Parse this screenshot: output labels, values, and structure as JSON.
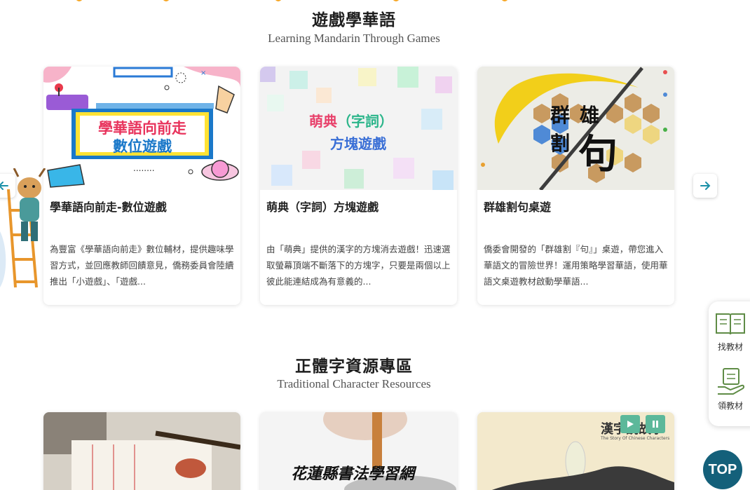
{
  "games": {
    "title": "遊戲學華語",
    "subtitle": "Learning Mandarin Through Games",
    "cards": [
      {
        "title": "學華語向前走-數位遊戲",
        "desc": "為豐富《學華語向前走》數位輔材，提供趣味學習方式，並回應教師回饋意見，僑務委員會陸續推出「小遊戲」、「遊戲...",
        "banner_line1": "學華語向前走",
        "banner_line2": "數位遊戲",
        "dots": "........"
      },
      {
        "title": "萌典（字詞）方塊遊戲",
        "desc": "由「萌典」提供的漢字的方塊消去遊戲！迅速選取螢幕頂端不斷落下的方塊字，只要是兩個以上彼此能連結成為有意義的...",
        "banner_a": "萌典",
        "banner_b": "（字詞）",
        "banner_c": "方塊遊戲"
      },
      {
        "title": "群雄割句桌遊",
        "desc": "僑委會開發的「群雄割『句』」桌遊，帶您進入華語文的冒險世界！運用策略學習華語，使用華語文桌遊教材啟動學華語...",
        "banner_a": "群",
        "banner_b": "雄",
        "banner_c": "割",
        "banner_d": "句"
      }
    ]
  },
  "traditional": {
    "title": "正體字資源專區",
    "subtitle": "Traditional Character Resources",
    "card2_text": "花蓮縣書法學習網",
    "card3_title": "漢字說故事",
    "card3_sub": "The Story Of Chinese Characters"
  },
  "side": {
    "find_label": "找教材",
    "get_label": "領教材"
  },
  "top_button": "TOP",
  "colors": {
    "accent_orange": "#f6a623",
    "top_blue": "#14607a",
    "arrow_teal": "#1a90a8",
    "icon_green": "#5f8c46"
  }
}
